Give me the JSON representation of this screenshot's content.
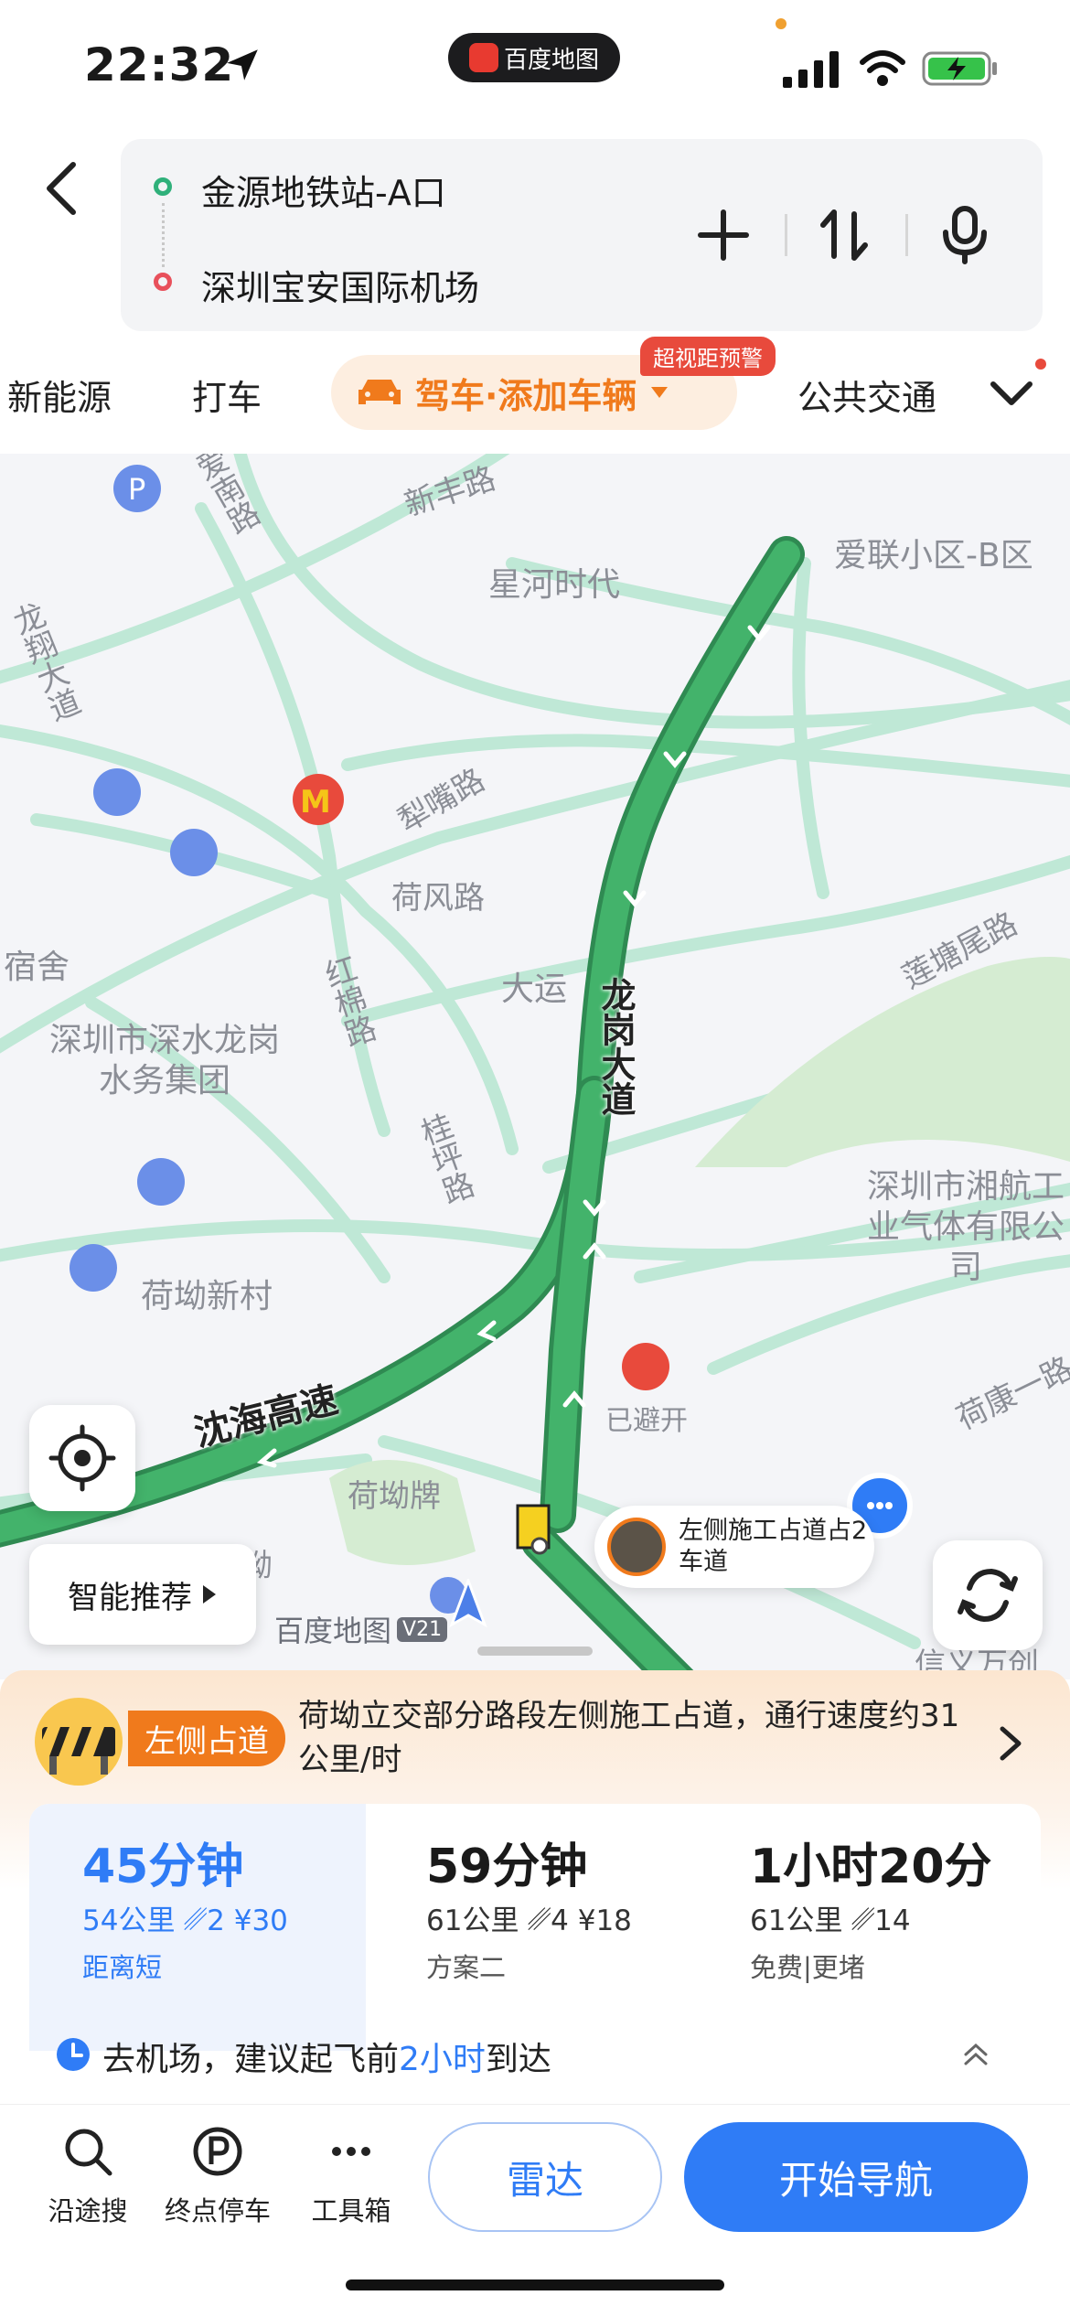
{
  "status_bar": {
    "time": "22:32",
    "app_name": "百度地图"
  },
  "route": {
    "start": "金源地铁站-A口",
    "end": "深圳宝安国际机场"
  },
  "tabs": [
    {
      "label": "新能源"
    },
    {
      "label": "打车"
    },
    {
      "label": "驾车·添加车辆",
      "active": true
    },
    {
      "label": "公共交通"
    }
  ],
  "drive_badge": "超视距预警",
  "map": {
    "places": [
      "新丰路",
      "星河时代",
      "爱联小区-B区",
      "龙翔大道",
      "爱南路",
      "犁嘴路",
      "荷风路",
      "宿舍",
      "大运",
      "龙岗大道",
      "莲塘尾路",
      "红棉路",
      "深圳市深水龙岗水务集团",
      "桂坪路",
      "深圳市湘航工业气体有限公司",
      "荷坳新村",
      "已避开",
      "荷康一路",
      "沈海高速",
      "荷坳牌",
      "荷坳",
      "信义万创"
    ],
    "construction_bubble": "左侧施工占道占2车道",
    "smart_recommend": "智能推荐",
    "watermark": "百度地图",
    "watermark_version": "V21",
    "colors": {
      "route": "#43b36b",
      "route_border": "#2f8a52",
      "road": "#bfe8d6"
    }
  },
  "alert": {
    "tag": "左侧占道",
    "text": "荷坳立交部分路段左侧施工占道，通行速度约31公里/时"
  },
  "plans": [
    {
      "time": "45分钟",
      "distance": "54公里",
      "lights": "2",
      "fee": "¥30",
      "tag": "距离短"
    },
    {
      "time": "59分钟",
      "distance": "61公里",
      "lights": "4",
      "fee": "¥18",
      "tag": "方案二"
    },
    {
      "time": "1小时20分",
      "distance": "61公里",
      "lights": "14",
      "fee": "",
      "tag": "免费|更堵"
    }
  ],
  "tip": {
    "prefix": "去机场，建议起飞前",
    "highlight": "2小时",
    "suffix": "到达"
  },
  "toolbar": {
    "search_along": "沿途搜",
    "end_parking": "终点停车",
    "toolbox": "工具箱",
    "radar": "雷达",
    "start_nav": "开始导航"
  },
  "accent_color": "#2f7cf6",
  "warning_color": "#f07a1c"
}
